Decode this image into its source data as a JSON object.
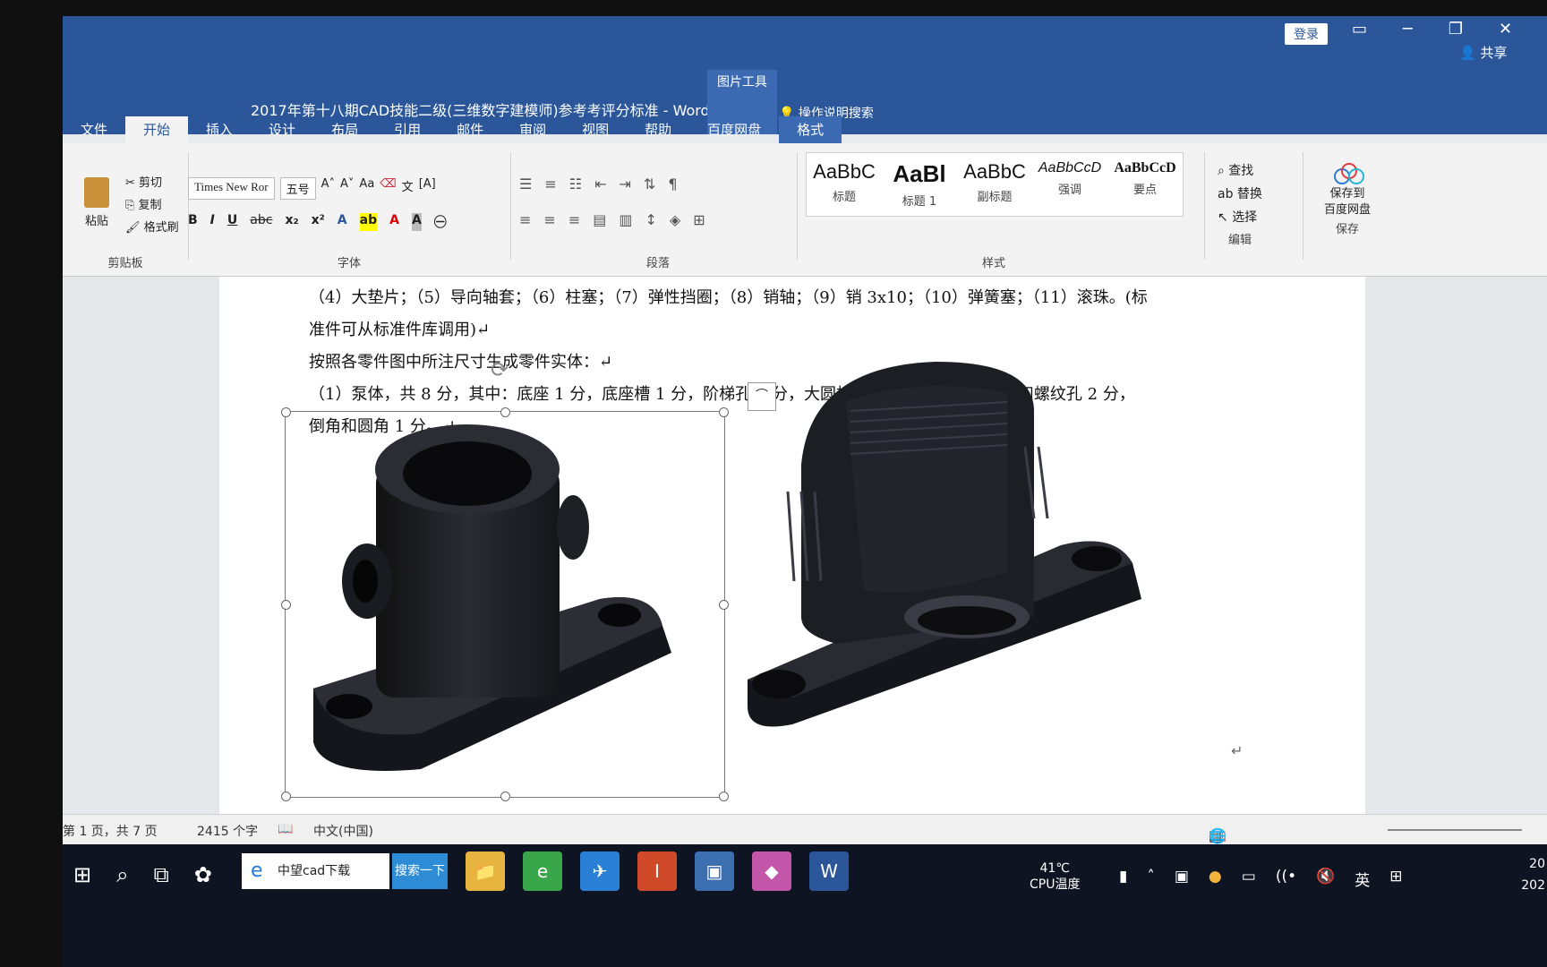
{
  "window": {
    "title": "2017年第十八期CAD技能二级(三维数字建模师)参考考评分标准  -  Word",
    "picture_tools": "图片工具",
    "login": "登录",
    "share": "共享",
    "tell_me": "操作说明搜索"
  },
  "tabs": [
    "文件",
    "开始",
    "插入",
    "设计",
    "布局",
    "引用",
    "邮件",
    "审阅",
    "视图",
    "帮助",
    "百度网盘",
    "格式"
  ],
  "ribbon": {
    "clipboard": {
      "paste": "粘贴",
      "cut": "剪切",
      "copy": "复制",
      "format_painter": "格式刷",
      "label": "剪贴板"
    },
    "font": {
      "name": "Times New Ror",
      "size": "五号",
      "label": "字体"
    },
    "paragraph": {
      "label": "段落"
    },
    "styles": {
      "items": [
        {
          "sample": "AaBbC",
          "name": "标题"
        },
        {
          "sample": "AaBl",
          "name": "标题 1"
        },
        {
          "sample": "AaBbC",
          "name": "副标题"
        },
        {
          "sample": "AaBbCcD",
          "name": "强调"
        },
        {
          "sample": "AaBbCcD",
          "name": "要点"
        }
      ],
      "label": "样式"
    },
    "editing": {
      "find": "查找",
      "replace": "替换",
      "select": "选择",
      "label": "编辑"
    },
    "save": {
      "line1": "保存到",
      "line2": "百度网盘",
      "label": "保存"
    }
  },
  "document": {
    "lines": [
      "（4）大垫片；（5）导向轴套；（6）柱塞；（7）弹性挡圈；（8）销轴；（9）销 3x10；（10）弹簧塞；（11）滚珠。(标",
      "准件可从标准件库调用)↵",
      "按照各零件图中所注尺寸生成零件实体：↵",
      "（1）泵体，共 8 分，其中：底座 1 分，底座槽 1 分，阶梯孔 1 分，大圆柱和内孔 2 分，小圆柱体和螺纹孔 2 分，",
      "倒角和圆角 1 分。↵"
    ]
  },
  "status": {
    "page": "第 1 页，共 7 页",
    "words": "2415 个字",
    "lang": "中文(中国)"
  },
  "taskbar": {
    "search_text": "中望cad下载",
    "search_button": "搜索一下",
    "temp": "41℃",
    "temp_label": "CPU温度",
    "ime": "英",
    "clock_line1": "20",
    "clock_line2": "202"
  },
  "colors": {
    "accent": "#2b579a",
    "taskbar": "#0e1422",
    "part": "#1e1f25"
  }
}
